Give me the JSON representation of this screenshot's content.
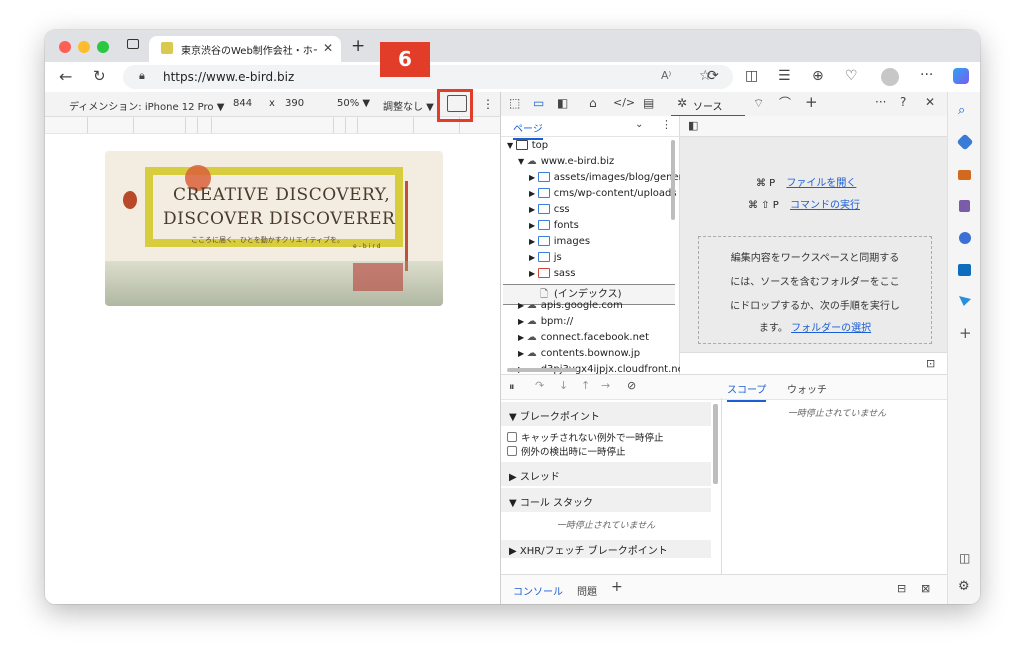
{
  "browser": {
    "tab_title": "東京渋谷のWeb制作会社・ホーム",
    "url": "https://www.e-bird.biz",
    "new_tab_symbol": "+",
    "reader_icon_text": "A⁾"
  },
  "device_toolbar": {
    "dimension_label": "ディメンション: iPhone 12 Pro ▼",
    "width": "844",
    "times": "x",
    "height": "390",
    "zoom": "50% ▼",
    "throttle": "調整なし ▼"
  },
  "callout": {
    "number": "6"
  },
  "hero": {
    "line1": "CREATIVE DISCOVERY,",
    "line2": "DISCOVER DISCOVERER",
    "subtitle": "こころに届く、ひとを動かすクリエイティブを。",
    "logo": "e-bird"
  },
  "devtools": {
    "sources_tab": "ソース",
    "pages_tab": "ページ",
    "tree": [
      {
        "label": "top",
        "kind": "frame",
        "indent": 0,
        "arrow": "▼"
      },
      {
        "label": "www.e-bird.biz",
        "kind": "cloud",
        "indent": 1,
        "arrow": "▼"
      },
      {
        "label": "assets/images/blog/gener",
        "kind": "folder",
        "indent": 2,
        "arrow": "▶"
      },
      {
        "label": "cms/wp-content/uploads",
        "kind": "folder",
        "indent": 2,
        "arrow": "▶"
      },
      {
        "label": "css",
        "kind": "folder",
        "indent": 2,
        "arrow": "▶"
      },
      {
        "label": "fonts",
        "kind": "folder",
        "indent": 2,
        "arrow": "▶"
      },
      {
        "label": "images",
        "kind": "folder",
        "indent": 2,
        "arrow": "▶"
      },
      {
        "label": "js",
        "kind": "folder",
        "indent": 2,
        "arrow": "▶"
      },
      {
        "label": "sass",
        "kind": "folder-red",
        "indent": 2,
        "arrow": "▶"
      },
      {
        "label": "(インデックス)",
        "kind": "file",
        "indent": 3,
        "arrow": ""
      },
      {
        "label": "apis.google.com",
        "kind": "cloud",
        "indent": 1,
        "arrow": "▶"
      },
      {
        "label": "bpm://",
        "kind": "cloud",
        "indent": 1,
        "arrow": "▶"
      },
      {
        "label": "connect.facebook.net",
        "kind": "cloud",
        "indent": 1,
        "arrow": "▶"
      },
      {
        "label": "contents.bownow.jp",
        "kind": "cloud",
        "indent": 1,
        "arrow": "▶"
      },
      {
        "label": "d3pj3vgx4ijpjx.cloudfront.ne",
        "kind": "cloud",
        "indent": 1,
        "arrow": "▶"
      }
    ],
    "shortcut_open_keys": "⌘ P",
    "shortcut_open": "ファイルを開く",
    "shortcut_cmd_keys": "⌘ ⇧ P",
    "shortcut_cmd": "コマンドの実行",
    "drop_lines": [
      "編集内容をワークスペースと同期する",
      "には、ソースを含むフォルダーをここ",
      "にドロップするか、次の手順を実行し"
    ],
    "drop_last_prefix": "ます。",
    "drop_link": "フォルダーの選択",
    "breakpoints": "ブレークポイント",
    "pause_uncaught": "キャッチされない例外で一時停止",
    "pause_caught": "例外の検出時に一時停止",
    "threads": "スレッド",
    "call_stack": "コール スタック",
    "not_paused": "一時停止されていません",
    "xhr_breakpoints": "XHR/フェッチ ブレークポイント",
    "scope_tab": "スコープ",
    "watch_tab": "ウォッチ",
    "scope_not_paused": "一時停止されていません",
    "console_tab": "コンソール",
    "issues_tab": "問題",
    "add_symbol": "+"
  }
}
